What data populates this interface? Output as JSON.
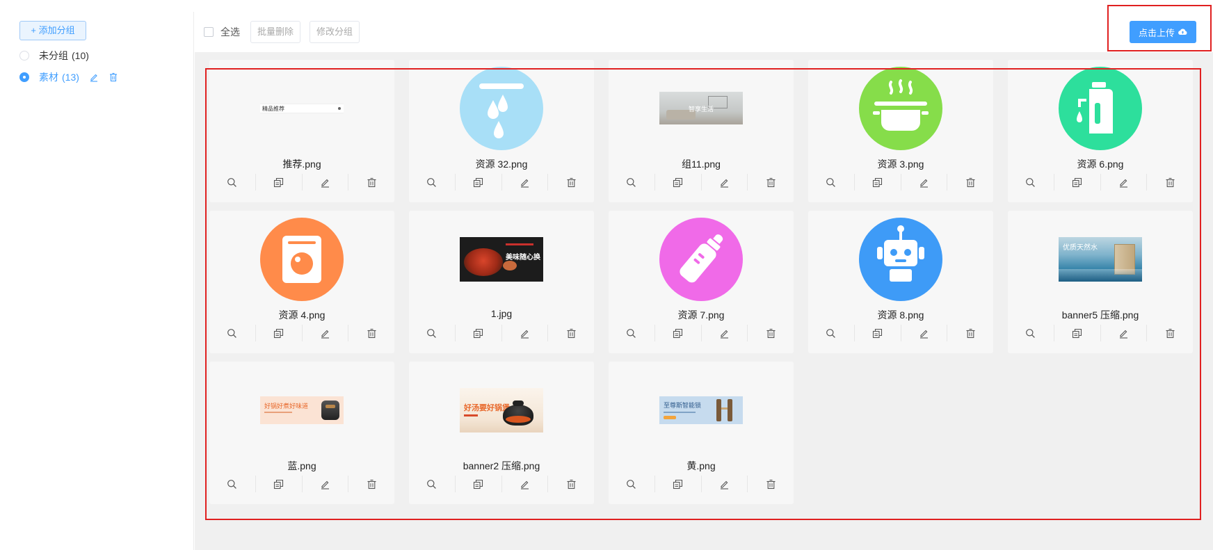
{
  "sidebar": {
    "add_group_label": "+ 添加分组",
    "groups": [
      {
        "name": "未分组",
        "count": "(10)",
        "active": false
      },
      {
        "name": "素材",
        "count": "(13)",
        "active": true
      }
    ]
  },
  "toolbar": {
    "select_all_label": "全选",
    "batch_delete_label": "批量删除",
    "change_group_label": "修改分组",
    "upload_label": "点击上传"
  },
  "colors": {
    "accent": "#409eff",
    "highlight": "#e02020"
  },
  "files": [
    {
      "name": "推荐.png",
      "thumb": "recommend-banner"
    },
    {
      "name": "资源 32.png",
      "thumb": "water-drops-icon"
    },
    {
      "name": "组11.png",
      "thumb": "living-room-banner"
    },
    {
      "name": "资源 3.png",
      "thumb": "cooking-pot-icon"
    },
    {
      "name": "资源 6.png",
      "thumb": "water-dispenser-icon"
    },
    {
      "name": "资源 4.png",
      "thumb": "washing-machine-icon"
    },
    {
      "name": "1.jpg",
      "thumb": "hotpot-banner"
    },
    {
      "name": "资源 7.png",
      "thumb": "baby-bottle-icon"
    },
    {
      "name": "资源 8.png",
      "thumb": "robot-icon"
    },
    {
      "name": "banner5 压缩.png",
      "thumb": "water-purifier-banner"
    },
    {
      "name": "蓝.png",
      "thumb": "rice-cooker-banner"
    },
    {
      "name": "banner2 压缩.png",
      "thumb": "soup-pot-banner"
    },
    {
      "name": "黄.png",
      "thumb": "smart-lock-banner"
    }
  ],
  "thumb_text": {
    "recommend": "精品推荐",
    "living_room": "智享生活",
    "hotpot": "美味随心换",
    "purifier": "优质天然水",
    "rice_cooker": "好锅好煮好味道",
    "soup": "好汤要好锅煲",
    "smart_lock": "至尊斯智能锁"
  },
  "card_tools": [
    "preview",
    "copy",
    "rename",
    "delete"
  ]
}
